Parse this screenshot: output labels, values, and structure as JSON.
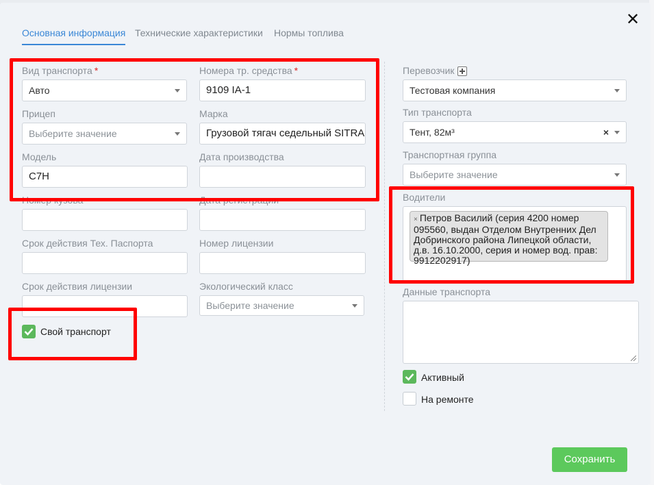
{
  "tabs": [
    {
      "label": "Основная информация",
      "active": true
    },
    {
      "label": "Технические характеристики",
      "active": false
    },
    {
      "label": "Нормы топлива",
      "active": false
    }
  ],
  "close_glyph": "✕",
  "left": {
    "vehicle_type": {
      "label": "Вид транспорта",
      "required_mark": "*",
      "value": "Авто"
    },
    "reg_number": {
      "label": "Номера тр. средства",
      "required_mark": "*",
      "value": "9109 IA-1"
    },
    "trailer": {
      "label": "Прицеп",
      "placeholder": "Выберите значение"
    },
    "brand": {
      "label": "Марка",
      "value": "Грузовой тягач седельный SITRAK"
    },
    "model": {
      "label": "Модель",
      "value": "C7H"
    },
    "production_date": {
      "label": "Дата производства",
      "value": ""
    },
    "body_number": {
      "label": "Номер кузова",
      "value": ""
    },
    "registration_date": {
      "label": "Дата регистрации",
      "value": ""
    },
    "tech_passport_expiry": {
      "label": "Срок действия Тех. Паспорта",
      "value": ""
    },
    "license_number": {
      "label": "Номер лицензии",
      "value": ""
    },
    "license_expiry": {
      "label": "Срок действия лицензии",
      "value": ""
    },
    "eco_class": {
      "label": "Экологический класс",
      "placeholder": "Выберите значение"
    },
    "own_transport": {
      "label": "Свой транспорт",
      "checked": true
    }
  },
  "right": {
    "carrier": {
      "label": "Перевозчик",
      "value": "Тестовая компания"
    },
    "transport_type": {
      "label": "Тип транспорта",
      "value": "Тент, 82м³",
      "clear_glyph": "×"
    },
    "transport_group": {
      "label": "Транспортная группа",
      "placeholder": "Выберите значение"
    },
    "drivers": {
      "label": "Водители",
      "tags": [
        "Петров Василий (серия 4200 номер 095560, выдан Отделом Внутренних Дел Добринского района Липецкой области, д.в. 16.10.2000, серия и номер вод. прав: 9912202917)"
      ],
      "tag_remove_glyph": "×"
    },
    "transport_data": {
      "label": "Данные транспорта",
      "value": ""
    },
    "active": {
      "label": "Активный",
      "checked": true
    },
    "under_repair": {
      "label": "На ремонте",
      "checked": false
    }
  },
  "save_button": {
    "label": "Сохранить"
  },
  "colors": {
    "accent": "#3a87d6",
    "success": "#5cc95c",
    "required": "#e02020",
    "annotation": "#ff0000",
    "modal_bg": "#f0f3f7"
  }
}
